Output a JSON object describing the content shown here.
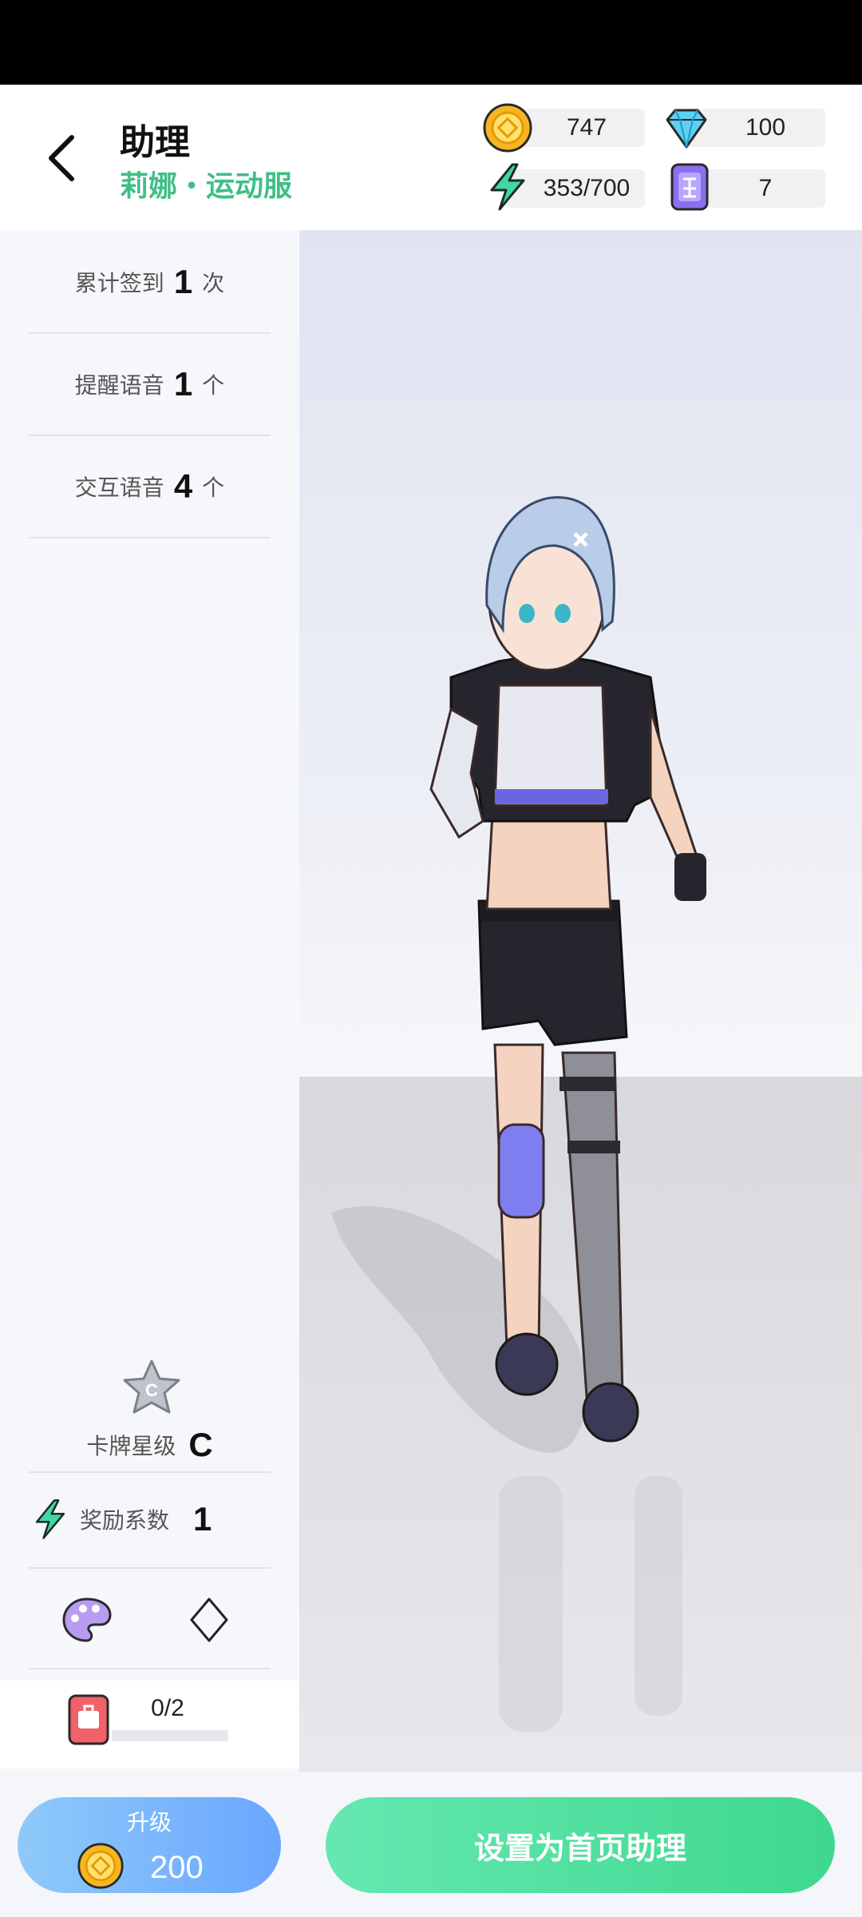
{
  "header": {
    "title": "助理",
    "subtitle": "莉娜・运动服"
  },
  "resources": {
    "coins": "747",
    "diamonds": "100",
    "energy": "353/700",
    "tickets": "7"
  },
  "stats": [
    {
      "label": "累计签到",
      "value": "1",
      "unit": "次"
    },
    {
      "label": "提醒语音",
      "value": "1",
      "unit": "个"
    },
    {
      "label": "交互语音",
      "value": "4",
      "unit": "个"
    }
  ],
  "card": {
    "star_label": "卡牌星级",
    "star_grade": "C",
    "reward_label": "奖励系数",
    "reward_value": "1"
  },
  "bag": {
    "count": "0/2",
    "progress_fraction": 0
  },
  "buttons": {
    "upgrade_label": "升级",
    "upgrade_cost": "200",
    "set_home": "设置为首页助理"
  },
  "colors": {
    "accent_green": "#3fbf86",
    "upgrade_blue": "#6aa6ff",
    "set_green": "#3ed890"
  }
}
